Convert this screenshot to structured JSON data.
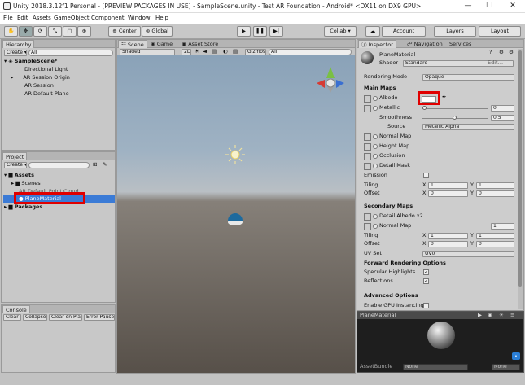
{
  "window": {
    "title": "Unity 2018.3.12f1 Personal - [PREVIEW PACKAGES IN USE] - SampleScene.unity - Test AR Foundation - Android* <DX11 on DX9 GPU>",
    "minimize": "—",
    "maximize": "☐",
    "close": "✕"
  },
  "menu": [
    "File",
    "Edit",
    "Assets",
    "GameObject",
    "Component",
    "Window",
    "Help"
  ],
  "toolbar": {
    "center": "Center",
    "global": "Global",
    "collab": "Collab ▾",
    "account": "Account",
    "layers": "Layers",
    "layout": "Layout"
  },
  "hierarchy": {
    "tab": "Hierarchy",
    "create": "Create ▾",
    "search_placeholder": "All",
    "scene": "SampleScene*",
    "items": [
      "Directional Light",
      "AR Session Origin",
      "AR Session",
      "AR Default Plane"
    ]
  },
  "project": {
    "tab": "Project",
    "create": "Create ▾",
    "folders": [
      "Assets",
      "Scenes",
      "AR Default Point Cloud",
      "PlaneMaterial",
      "Packages"
    ]
  },
  "console": {
    "tab": "Console",
    "buttons": [
      "Clear",
      "Collapse",
      "Clear on Play",
      "Error Pause"
    ]
  },
  "scene_tabs": [
    "Scene",
    "Game",
    "Asset Store"
  ],
  "scene_bar": {
    "shading": "Shaded",
    "mode_2d": "2D",
    "gizmos": "Gizmos ▾",
    "search_placeholder": "All"
  },
  "inspector": {
    "tabs": [
      "Inspector",
      "Navigation",
      "Services"
    ],
    "material_name": "PlaneMaterial",
    "shader_label": "Shader",
    "shader_value": "Standard",
    "rendering_mode_label": "Rendering Mode",
    "rendering_mode_value": "Opaque",
    "main_maps": "Main Maps",
    "albedo": "Albedo",
    "metallic": "Metallic",
    "metallic_value": "0",
    "smoothness": "Smoothness",
    "smoothness_value": "0.5",
    "source_label": "Source",
    "source_value": "Metallic Alpha",
    "normal_map": "Normal Map",
    "height_map": "Height Map",
    "occlusion": "Occlusion",
    "detail_mask": "Detail Mask",
    "emission": "Emission",
    "tiling": "Tiling",
    "offset": "Offset",
    "tiling_x": "1",
    "tiling_y": "1",
    "offset_x": "0",
    "offset_y": "0",
    "x_label": "X",
    "y_label": "Y",
    "secondary_maps": "Secondary Maps",
    "detail_albedo": "Detail Albedo x2",
    "sec_normal_map": "Normal Map",
    "sec_normal_value": "1",
    "sec_tiling_x": "1",
    "sec_tiling_y": "1",
    "sec_offset_x": "0",
    "sec_offset_y": "0",
    "uv_set_label": "UV Set",
    "uv_set_value": "UV0",
    "forward_options": "Forward Rendering Options",
    "specular_highlights": "Specular Highlights",
    "reflections": "Reflections",
    "advanced_options": "Advanced Options",
    "gpu_instancing": "Enable GPU Instancing"
  },
  "preview": {
    "title": "PlaneMaterial",
    "assetbundle_label": "AssetBundle",
    "assetbundle_value": "None",
    "variant_value": "None"
  }
}
